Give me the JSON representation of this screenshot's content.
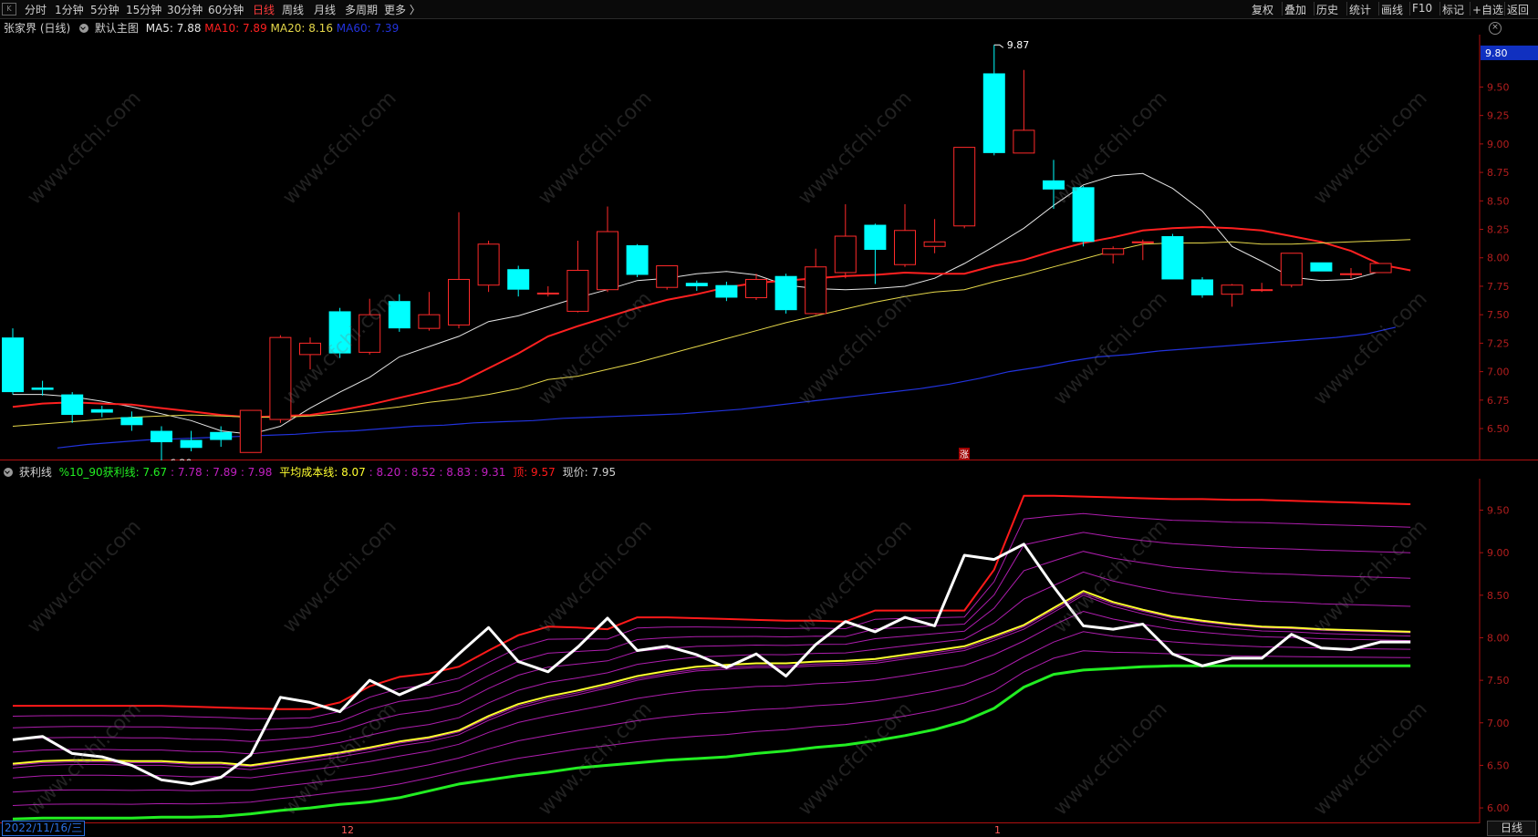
{
  "toolbar": {
    "corner": "K",
    "periods": [
      "分时",
      "1分钟",
      "5分钟",
      "15分钟",
      "30分钟",
      "60分钟",
      "日线",
      "周线",
      "月线",
      "多周期",
      "更多 〉"
    ],
    "active": "日线",
    "right": [
      "复权",
      "叠加",
      "历史",
      "统计",
      "画线",
      "F10",
      "标记",
      "+自选",
      "返回"
    ]
  },
  "main_panel": {
    "stock": "张家界 (日线)",
    "chart_name": "默认主图",
    "ma5": "MA5: 7.88",
    "ma10": "MA10: 7.89",
    "ma20": "MA20: 8.16",
    "ma60": "MA60: 7.39",
    "high_label": "9.87",
    "low_label": "6.20",
    "price_tag": "9.80",
    "zhang": "涨"
  },
  "sub_panel": {
    "name": "获利线",
    "p1": "%10_90获利线: 7.67",
    "p1b": ": 7.78 : 7.89 : 7.98",
    "p2": "平均成本线: 8.07",
    "p2b": ": 8.20 : 8.52 : 8.83 : 9.31",
    "p3": "顶: 9.57",
    "p4": "现价: 7.95"
  },
  "footer": {
    "date": "2022/11/16/三",
    "month_12": "12",
    "month_1": "1",
    "tab": "日线"
  },
  "watermark": "www.cfchi.com",
  "colors": {
    "up": "#ff2a2a",
    "down": "#00ffff",
    "ma5": "#e6e6e6",
    "ma10": "#ff2020",
    "ma20": "#e6d84a",
    "ma60": "#2233dd",
    "profit_low": "#22ee22",
    "cost": "#ffff30",
    "top": "#ff1a1a",
    "band": "#c020c0",
    "price": "#ffffff"
  },
  "chart_data": [
    {
      "type": "candlestick",
      "title": "张家界 (日线)",
      "yticks": [
        6.5,
        6.75,
        7.0,
        7.25,
        7.5,
        7.75,
        8.0,
        8.25,
        8.5,
        8.75,
        9.0,
        9.25,
        9.5
      ],
      "ylim": [
        6.22,
        9.96
      ],
      "candles": [
        {
          "o": 7.3,
          "h": 7.38,
          "l": 6.8,
          "c": 6.82
        },
        {
          "o": 6.86,
          "h": 6.92,
          "l": 6.79,
          "c": 6.84
        },
        {
          "o": 6.8,
          "h": 6.82,
          "l": 6.55,
          "c": 6.62
        },
        {
          "o": 6.67,
          "h": 6.7,
          "l": 6.6,
          "c": 6.64
        },
        {
          "o": 6.6,
          "h": 6.65,
          "l": 6.48,
          "c": 6.53
        },
        {
          "o": 6.48,
          "h": 6.52,
          "l": 6.2,
          "c": 6.38
        },
        {
          "o": 6.4,
          "h": 6.48,
          "l": 6.3,
          "c": 6.33
        },
        {
          "o": 6.47,
          "h": 6.52,
          "l": 6.34,
          "c": 6.4
        },
        {
          "o": 6.29,
          "h": 6.66,
          "l": 6.29,
          "c": 6.66
        },
        {
          "o": 6.58,
          "h": 7.32,
          "l": 6.55,
          "c": 7.3
        },
        {
          "o": 7.15,
          "h": 7.3,
          "l": 7.02,
          "c": 7.25
        },
        {
          "o": 7.53,
          "h": 7.56,
          "l": 7.12,
          "c": 7.16
        },
        {
          "o": 7.17,
          "h": 7.64,
          "l": 7.15,
          "c": 7.5
        },
        {
          "o": 7.62,
          "h": 7.68,
          "l": 7.35,
          "c": 7.38
        },
        {
          "o": 7.38,
          "h": 7.7,
          "l": 7.36,
          "c": 7.5
        },
        {
          "o": 7.41,
          "h": 8.4,
          "l": 7.38,
          "c": 7.81
        },
        {
          "o": 7.76,
          "h": 8.15,
          "l": 7.7,
          "c": 8.12
        },
        {
          "o": 7.9,
          "h": 7.93,
          "l": 7.66,
          "c": 7.72
        },
        {
          "o": 7.69,
          "h": 7.75,
          "l": 7.66,
          "c": 7.69
        },
        {
          "o": 7.53,
          "h": 8.15,
          "l": 7.52,
          "c": 7.89
        },
        {
          "o": 7.72,
          "h": 8.45,
          "l": 7.7,
          "c": 8.23
        },
        {
          "o": 8.11,
          "h": 8.12,
          "l": 7.83,
          "c": 7.85
        },
        {
          "o": 7.74,
          "h": 7.92,
          "l": 7.72,
          "c": 7.93
        },
        {
          "o": 7.78,
          "h": 7.8,
          "l": 7.71,
          "c": 7.75
        },
        {
          "o": 7.76,
          "h": 7.79,
          "l": 7.62,
          "c": 7.65
        },
        {
          "o": 7.65,
          "h": 7.86,
          "l": 7.63,
          "c": 7.81
        },
        {
          "o": 7.84,
          "h": 7.86,
          "l": 7.51,
          "c": 7.54
        },
        {
          "o": 7.51,
          "h": 8.08,
          "l": 7.5,
          "c": 7.92
        },
        {
          "o": 7.87,
          "h": 8.47,
          "l": 7.82,
          "c": 8.19
        },
        {
          "o": 8.29,
          "h": 8.3,
          "l": 7.77,
          "c": 8.07
        },
        {
          "o": 7.94,
          "h": 8.47,
          "l": 7.92,
          "c": 8.24
        },
        {
          "o": 8.1,
          "h": 8.34,
          "l": 8.04,
          "c": 8.14
        },
        {
          "o": 8.28,
          "h": 8.28,
          "l": 8.26,
          "c": 8.97
        },
        {
          "o": 9.62,
          "h": 9.87,
          "l": 8.9,
          "c": 8.92
        },
        {
          "o": 8.92,
          "h": 9.65,
          "l": 8.92,
          "c": 9.12
        },
        {
          "o": 8.68,
          "h": 8.86,
          "l": 8.43,
          "c": 8.6
        },
        {
          "o": 8.62,
          "h": 8.63,
          "l": 8.1,
          "c": 8.14
        },
        {
          "o": 8.03,
          "h": 8.1,
          "l": 7.95,
          "c": 8.08
        },
        {
          "o": 8.14,
          "h": 8.16,
          "l": 7.98,
          "c": 8.14
        },
        {
          "o": 8.19,
          "h": 8.21,
          "l": 7.81,
          "c": 7.81
        },
        {
          "o": 7.81,
          "h": 7.83,
          "l": 7.65,
          "c": 7.67
        },
        {
          "o": 7.68,
          "h": 7.77,
          "l": 7.57,
          "c": 7.76
        },
        {
          "o": 7.72,
          "h": 7.78,
          "l": 7.7,
          "c": 7.72
        },
        {
          "o": 7.76,
          "h": 8.04,
          "l": 7.74,
          "c": 8.04
        },
        {
          "o": 7.96,
          "h": 7.96,
          "l": 7.88,
          "c": 7.88
        },
        {
          "o": 7.86,
          "h": 7.91,
          "l": 7.82,
          "c": 7.86
        },
        {
          "o": 7.87,
          "h": 7.93,
          "l": 7.87,
          "c": 7.95
        }
      ],
      "series": [
        {
          "name": "MA5",
          "values": [
            6.8,
            6.8,
            6.78,
            6.74,
            6.69,
            6.63,
            6.57,
            6.48,
            6.45,
            6.52,
            6.68,
            6.82,
            6.95,
            7.13,
            7.22,
            7.31,
            7.44,
            7.49,
            7.57,
            7.65,
            7.72,
            7.8,
            7.82,
            7.86,
            7.88,
            7.85,
            7.76,
            7.73,
            7.72,
            7.73,
            7.75,
            7.82,
            7.95,
            8.1,
            8.26,
            8.46,
            8.64,
            8.72,
            8.74,
            8.61,
            8.41,
            8.1,
            7.97,
            7.83,
            7.8,
            7.81,
            7.88
          ]
        },
        {
          "name": "MA10",
          "values": [
            6.69,
            6.72,
            6.73,
            6.72,
            6.71,
            6.68,
            6.65,
            6.62,
            6.6,
            6.61,
            6.62,
            6.66,
            6.71,
            6.77,
            6.83,
            6.9,
            7.03,
            7.16,
            7.31,
            7.4,
            7.48,
            7.56,
            7.63,
            7.68,
            7.74,
            7.78,
            7.8,
            7.82,
            7.84,
            7.85,
            7.87,
            7.86,
            7.86,
            7.93,
            7.98,
            8.06,
            8.13,
            8.18,
            8.24,
            8.26,
            8.27,
            8.26,
            8.24,
            8.19,
            8.14,
            8.06,
            7.94,
            7.89
          ]
        },
        {
          "name": "MA20",
          "values": [
            6.52,
            6.54,
            6.56,
            6.58,
            6.6,
            6.61,
            6.62,
            6.61,
            6.6,
            6.6,
            6.61,
            6.63,
            6.66,
            6.69,
            6.73,
            6.76,
            6.8,
            6.85,
            6.93,
            6.96,
            7.02,
            7.08,
            7.15,
            7.22,
            7.29,
            7.36,
            7.43,
            7.49,
            7.55,
            7.61,
            7.66,
            7.7,
            7.72,
            7.79,
            7.85,
            7.92,
            7.99,
            8.06,
            8.12,
            8.13,
            8.13,
            8.14,
            8.12,
            8.12,
            8.13,
            8.14,
            8.15,
            8.16
          ]
        },
        {
          "name": "MA60",
          "values": [
            6.33,
            6.36,
            6.38,
            6.4,
            6.41,
            6.42,
            6.43,
            6.44,
            6.45,
            6.47,
            6.48,
            6.5,
            6.52,
            6.53,
            6.55,
            6.56,
            6.57,
            6.59,
            6.6,
            6.61,
            6.62,
            6.63,
            6.65,
            6.67,
            6.7,
            6.73,
            6.76,
            6.79,
            6.82,
            6.85,
            6.89,
            6.94,
            7.0,
            7.04,
            7.09,
            7.13,
            7.15,
            7.18,
            7.2,
            7.22,
            7.24,
            7.26,
            7.28,
            7.3,
            7.33,
            7.39
          ]
        }
      ]
    },
    {
      "type": "line",
      "title": "获利线",
      "yticks": [
        6.0,
        6.5,
        7.0,
        7.5,
        8.0,
        8.5,
        9.0,
        9.5
      ],
      "ylim": [
        5.84,
        9.87
      ],
      "series": [
        {
          "name": "%10_90获利线",
          "values": [
            5.87,
            5.88,
            5.88,
            5.88,
            5.88,
            5.89,
            5.89,
            5.9,
            5.93,
            5.97,
            6.0,
            6.04,
            6.07,
            6.12,
            6.2,
            6.28,
            6.33,
            6.38,
            6.42,
            6.47,
            6.5,
            6.53,
            6.56,
            6.58,
            6.6,
            6.64,
            6.67,
            6.71,
            6.74,
            6.79,
            6.85,
            6.92,
            7.02,
            7.17,
            7.42,
            7.57,
            7.62,
            7.64,
            7.66,
            7.67,
            7.67,
            7.67,
            7.67,
            7.67,
            7.67,
            7.67,
            7.67,
            7.67
          ]
        },
        {
          "name": "平均成本线",
          "values": [
            6.52,
            6.55,
            6.56,
            6.56,
            6.55,
            6.55,
            6.53,
            6.53,
            6.5,
            6.55,
            6.6,
            6.65,
            6.71,
            6.78,
            6.83,
            6.91,
            7.08,
            7.22,
            7.31,
            7.38,
            7.46,
            7.55,
            7.61,
            7.66,
            7.68,
            7.7,
            7.7,
            7.72,
            7.73,
            7.75,
            7.8,
            7.85,
            7.9,
            8.02,
            8.15,
            8.35,
            8.55,
            8.42,
            8.33,
            8.25,
            8.2,
            8.16,
            8.13,
            8.12,
            8.1,
            8.09,
            8.08,
            8.07
          ]
        },
        {
          "name": "顶",
          "values": [
            7.2,
            7.2,
            7.2,
            7.2,
            7.2,
            7.2,
            7.19,
            7.18,
            7.17,
            7.16,
            7.16,
            7.24,
            7.43,
            7.54,
            7.58,
            7.66,
            7.85,
            8.03,
            8.13,
            8.12,
            8.1,
            8.24,
            8.24,
            8.23,
            8.22,
            8.21,
            8.2,
            8.2,
            8.19,
            8.32,
            8.32,
            8.32,
            8.32,
            8.8,
            9.67,
            9.67,
            9.66,
            9.65,
            9.64,
            9.63,
            9.63,
            9.62,
            9.62,
            9.61,
            9.6,
            9.59,
            9.58,
            9.57
          ]
        },
        {
          "name": "现价",
          "values": [
            6.8,
            6.84,
            6.64,
            6.6,
            6.5,
            6.33,
            6.28,
            6.36,
            6.62,
            7.3,
            7.24,
            7.13,
            7.5,
            7.33,
            7.48,
            7.81,
            8.12,
            7.72,
            7.6,
            7.89,
            8.23,
            7.85,
            7.9,
            7.8,
            7.65,
            7.81,
            7.55,
            7.92,
            8.19,
            8.07,
            8.24,
            8.14,
            8.97,
            8.92,
            9.1,
            8.6,
            8.14,
            8.1,
            8.16,
            7.81,
            7.67,
            7.76,
            7.76,
            8.04,
            7.88,
            7.86,
            7.95,
            7.95
          ]
        }
      ]
    }
  ]
}
